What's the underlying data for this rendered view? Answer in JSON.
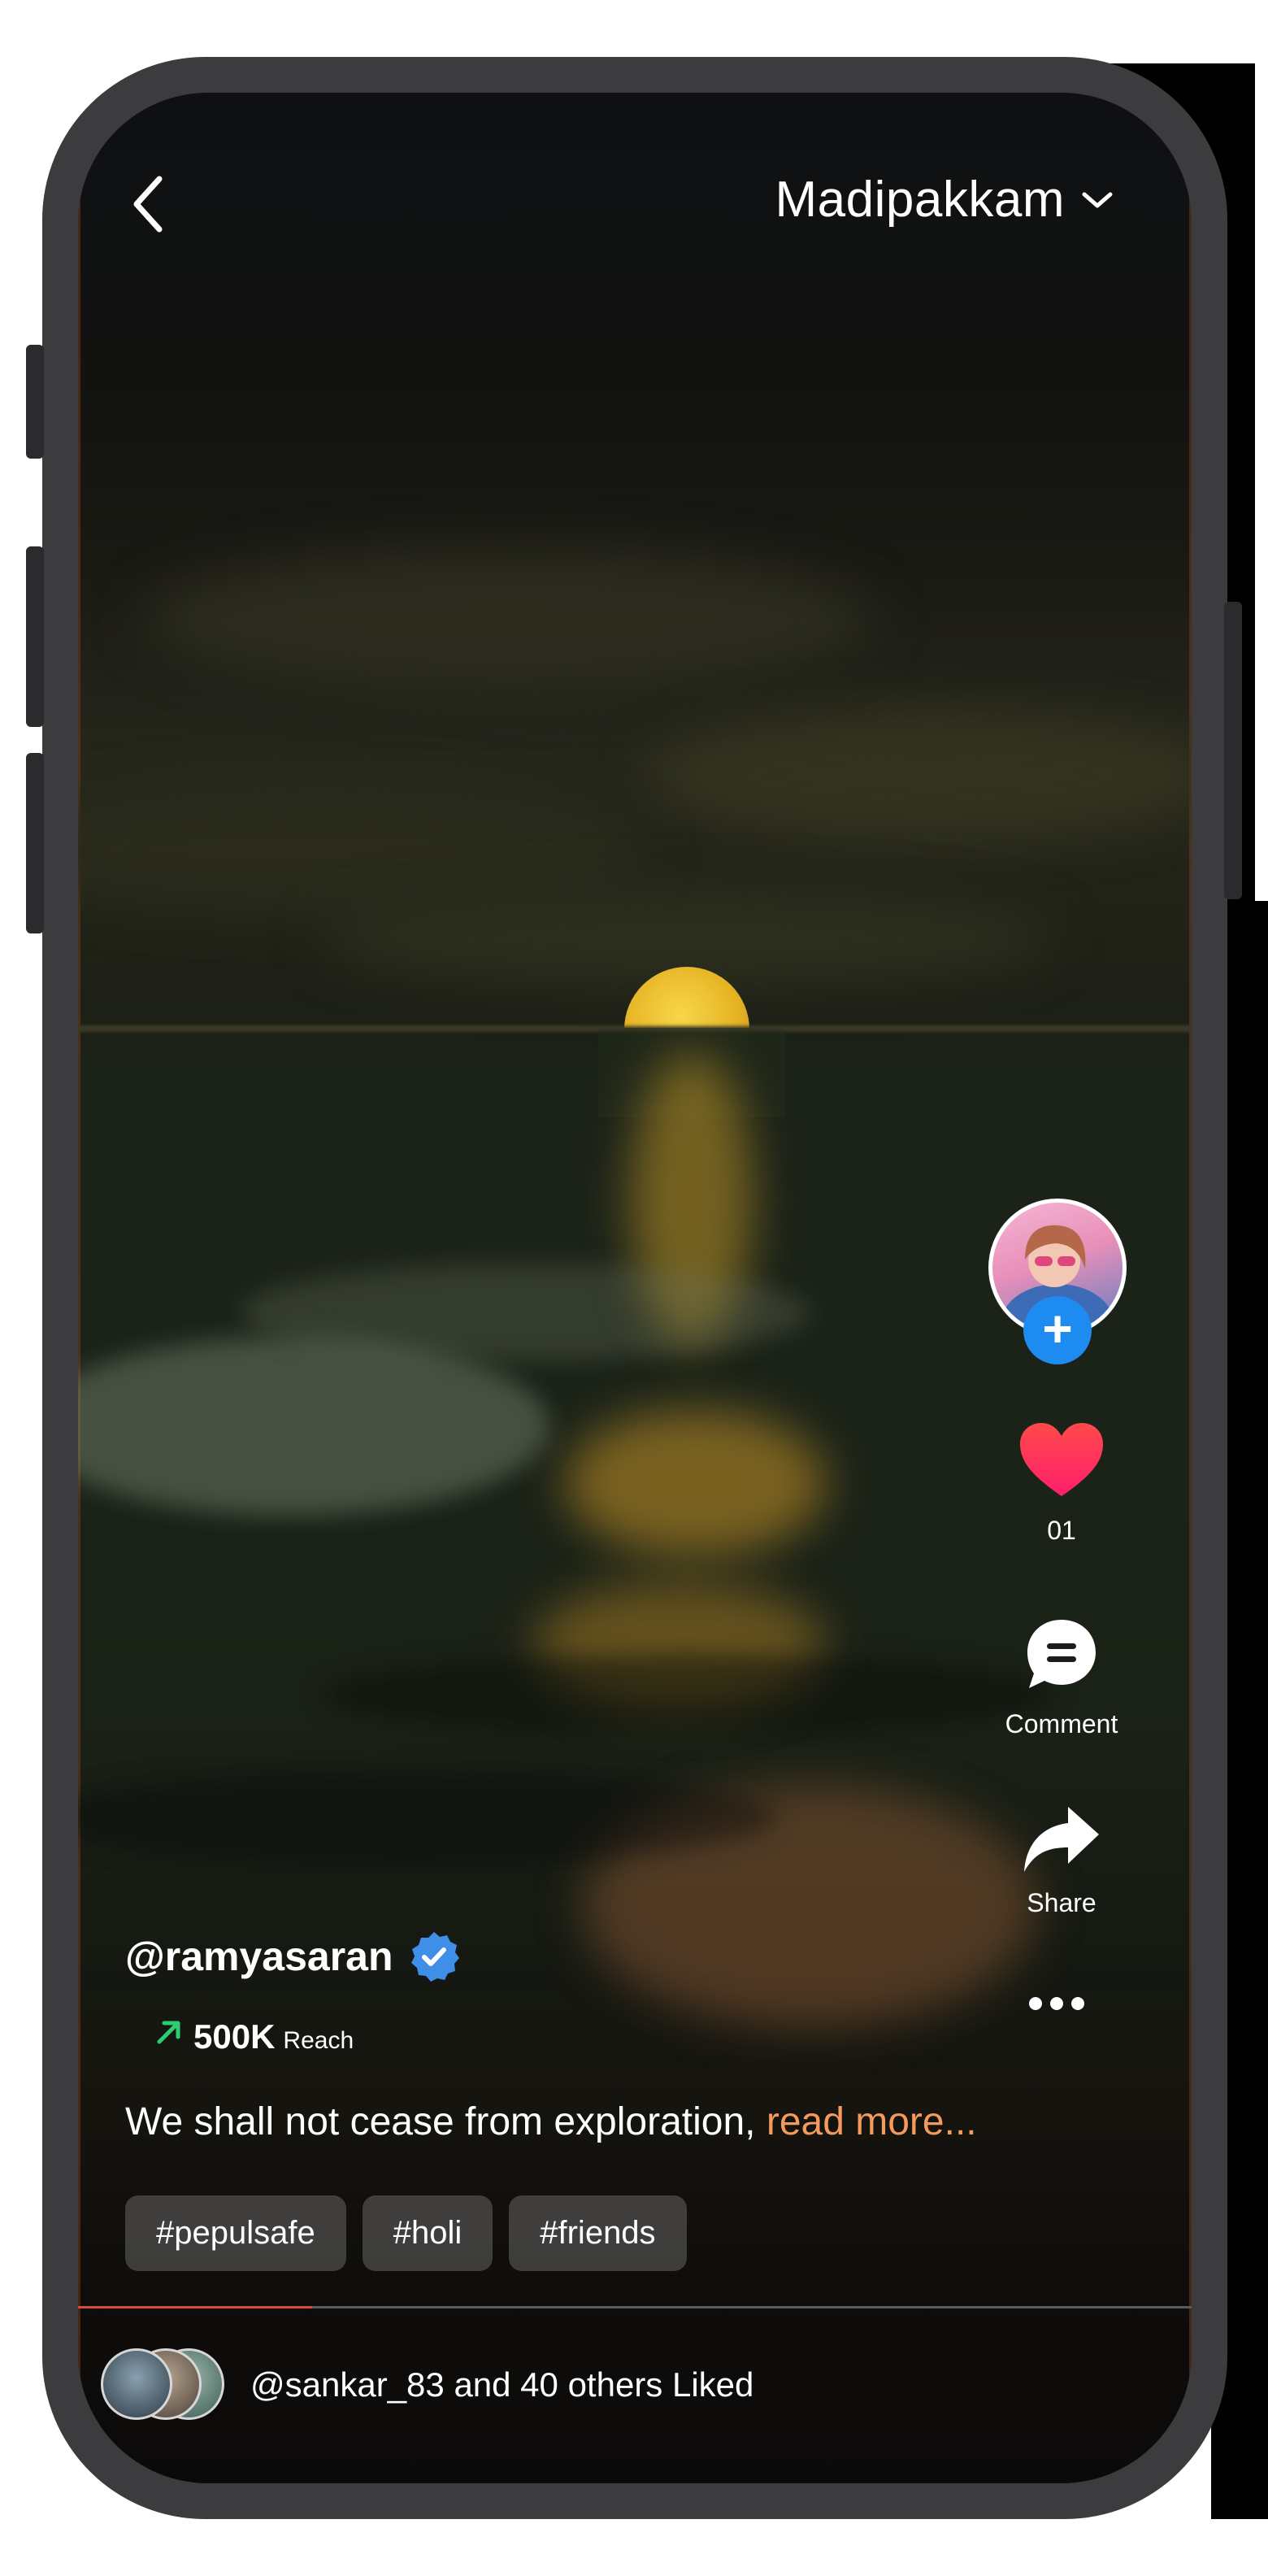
{
  "header": {
    "location": "Madipakkam",
    "back_icon": "chevron-left-icon",
    "dropdown_icon": "chevron-down-icon"
  },
  "rail": {
    "like_count": "01",
    "comment_label": "Comment",
    "share_label": "Share"
  },
  "post": {
    "username": "@ramyasaran",
    "reach_value": "500K",
    "reach_label": "Reach",
    "caption": "We shall not cease from exploration, ",
    "read_more": "read more...",
    "tags": [
      "#pepulsafe",
      "#holi",
      "#friends"
    ],
    "progress": 0.21
  },
  "likes": {
    "text": "@sankar_83 and 40 others Liked"
  },
  "colors": {
    "accent": "#f39a5c",
    "verify_blue": "#3f8ee8",
    "plus_blue": "#1e8bf0",
    "heart": "#ff2d4f",
    "reach_arrow": "#2ecc71"
  }
}
